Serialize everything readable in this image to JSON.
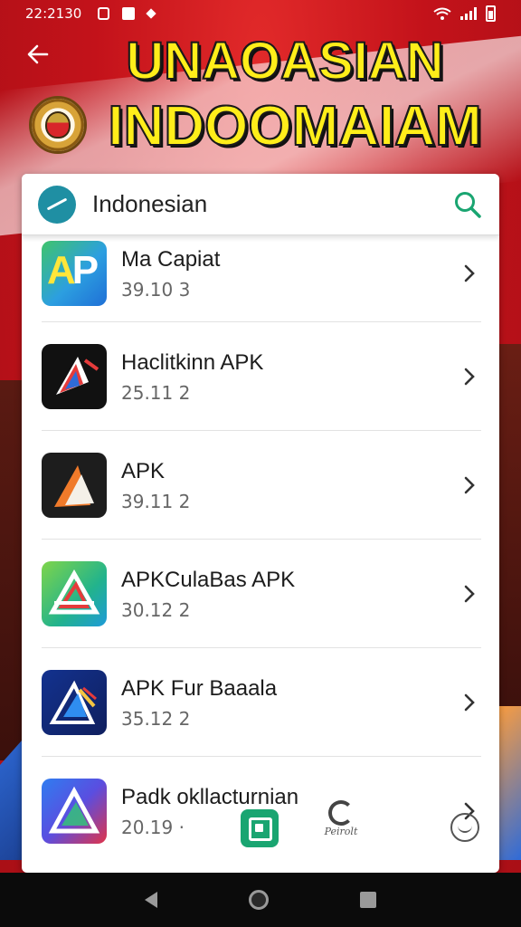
{
  "status_bar": {
    "time": "22:2130"
  },
  "header": {
    "title_line1": "UNAOASIAN",
    "title_line2": "INDOOMAIAM"
  },
  "search": {
    "title": "Indonesian"
  },
  "apps": [
    {
      "name": "Ma Capiat",
      "meta": "39.10 3"
    },
    {
      "name": "Haclitkinn APK",
      "meta": "25.11 2"
    },
    {
      "name": "APK",
      "meta": "39.11 2"
    },
    {
      "name": "APKCulaBas APK",
      "meta": "30.12 2"
    },
    {
      "name": "APK Fur Baaala",
      "meta": "35.12 2"
    },
    {
      "name": "Padk okllacturnian",
      "meta": "20.19 ‧"
    }
  ],
  "bottom_tools": {
    "parrot_label": "Peirolt"
  },
  "colors": {
    "background_red": "#c3121a",
    "headline_yellow": "#ffee1a",
    "accent_green": "#1aa571",
    "search_logo_teal": "#1f8fa3"
  }
}
